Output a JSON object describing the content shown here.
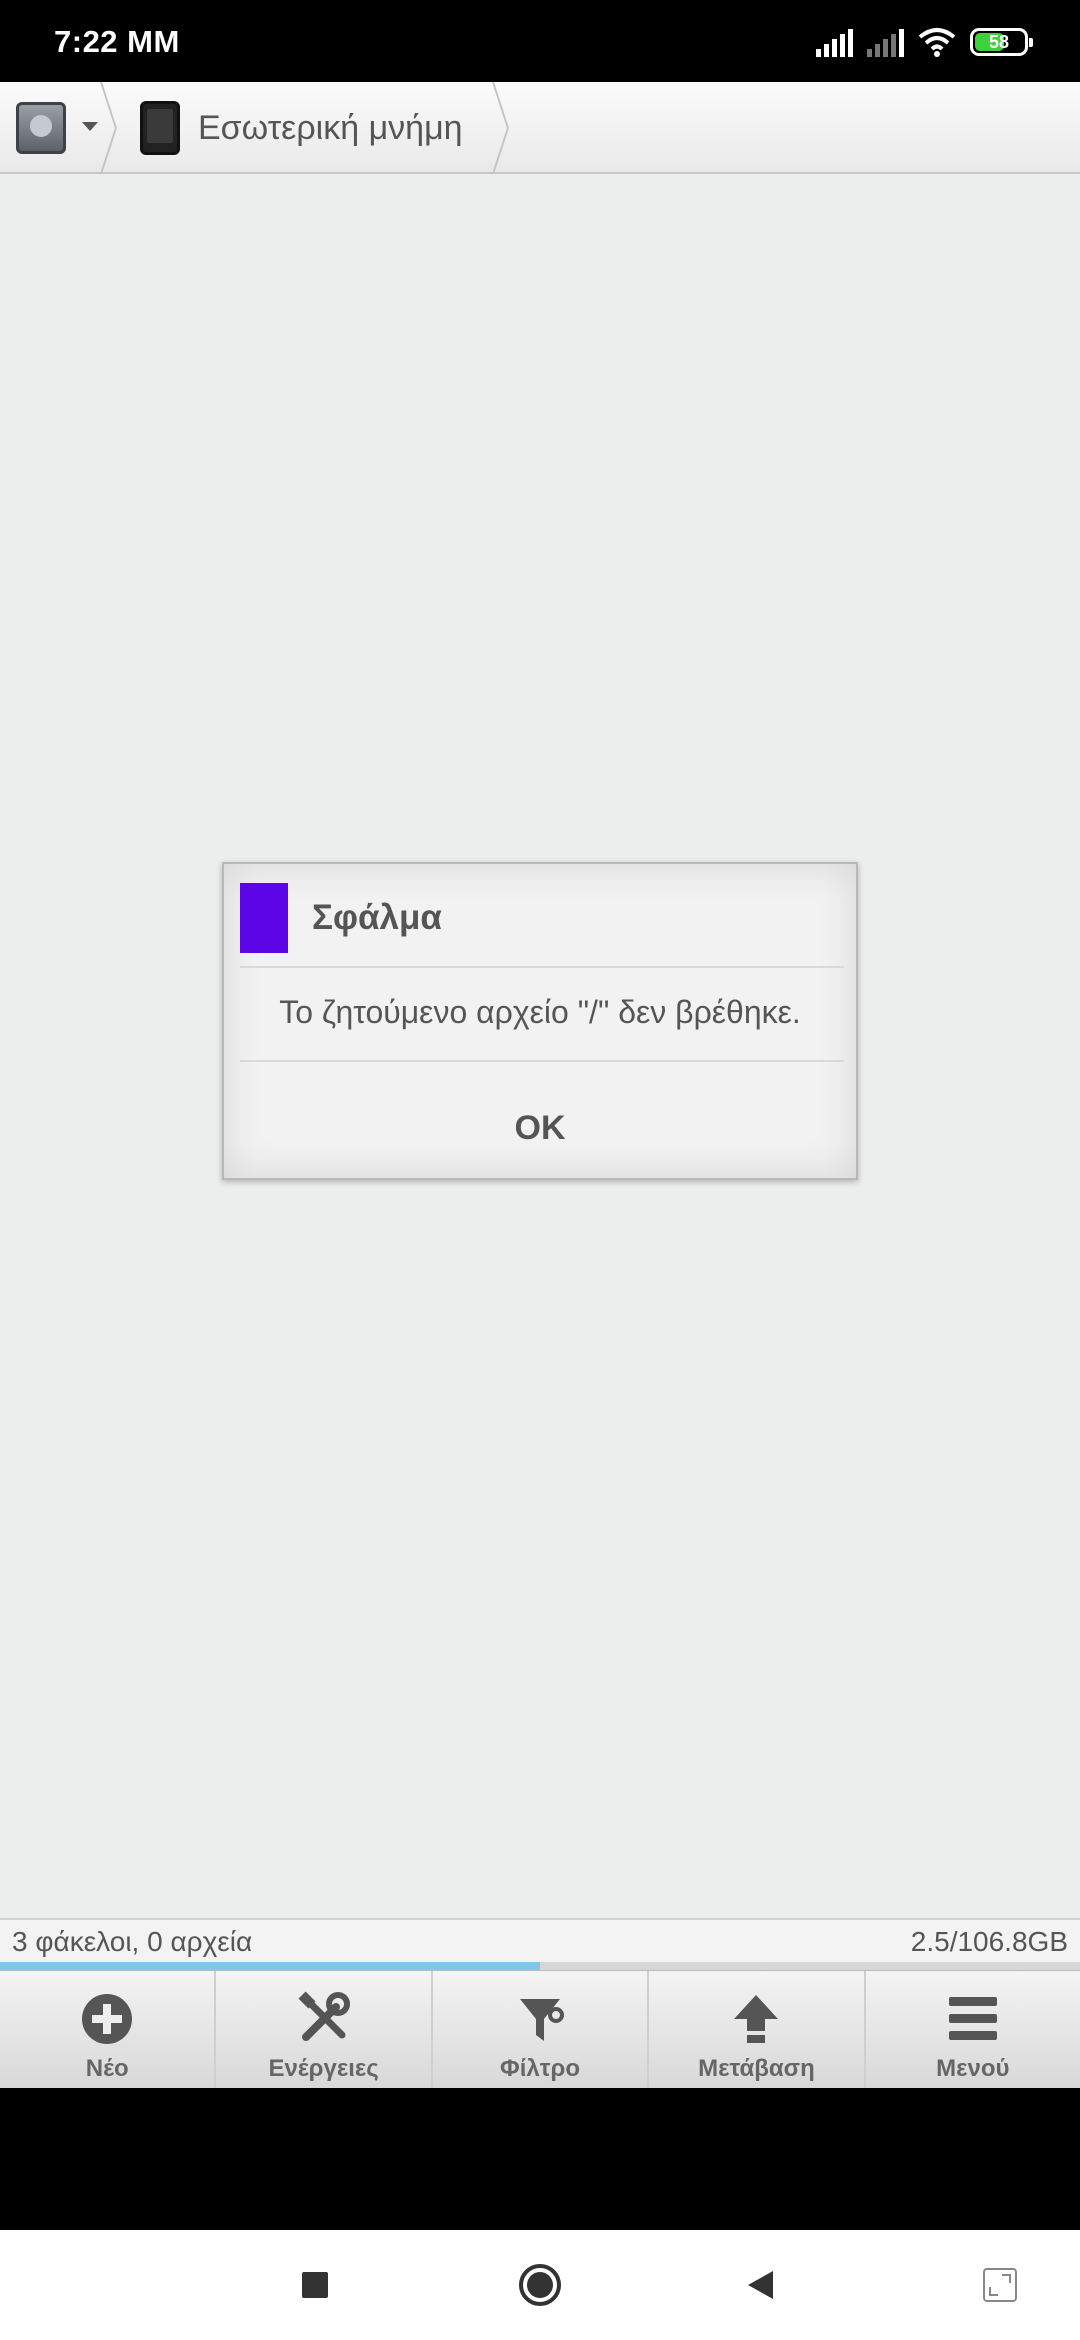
{
  "status_bar": {
    "time": "7:22 ΜΜ",
    "battery": "58",
    "icons": [
      "signal-icon",
      "signal-icon",
      "wifi-icon",
      "battery-icon"
    ]
  },
  "toolbar": {
    "root_icon": "android-icon",
    "location_label": "Εσωτερική μνήμη"
  },
  "dialog": {
    "title": "Σφάλμα",
    "color": "#5c06e8",
    "message": "Το ζητούμενο αρχείο \"/\" δεν βρέθηκε.",
    "ok_label": "OK"
  },
  "info_bar": {
    "summary": "3 φάκελοι, 0 αρχεία",
    "storage": "2.5/106.8GB",
    "usage_fraction": 0.5
  },
  "actions": [
    {
      "label": "Νέο",
      "icon": "plus-circle-icon"
    },
    {
      "label": "Ενέργειες",
      "icon": "tools-icon"
    },
    {
      "label": "Φίλτρο",
      "icon": "filter-icon"
    },
    {
      "label": "Μετάβαση",
      "icon": "arrow-up-icon"
    },
    {
      "label": "Μενού",
      "icon": "menu-icon"
    }
  ],
  "nav": [
    "recents-square-icon",
    "home-circle-icon",
    "back-triangle-icon",
    "expand-icon"
  ]
}
